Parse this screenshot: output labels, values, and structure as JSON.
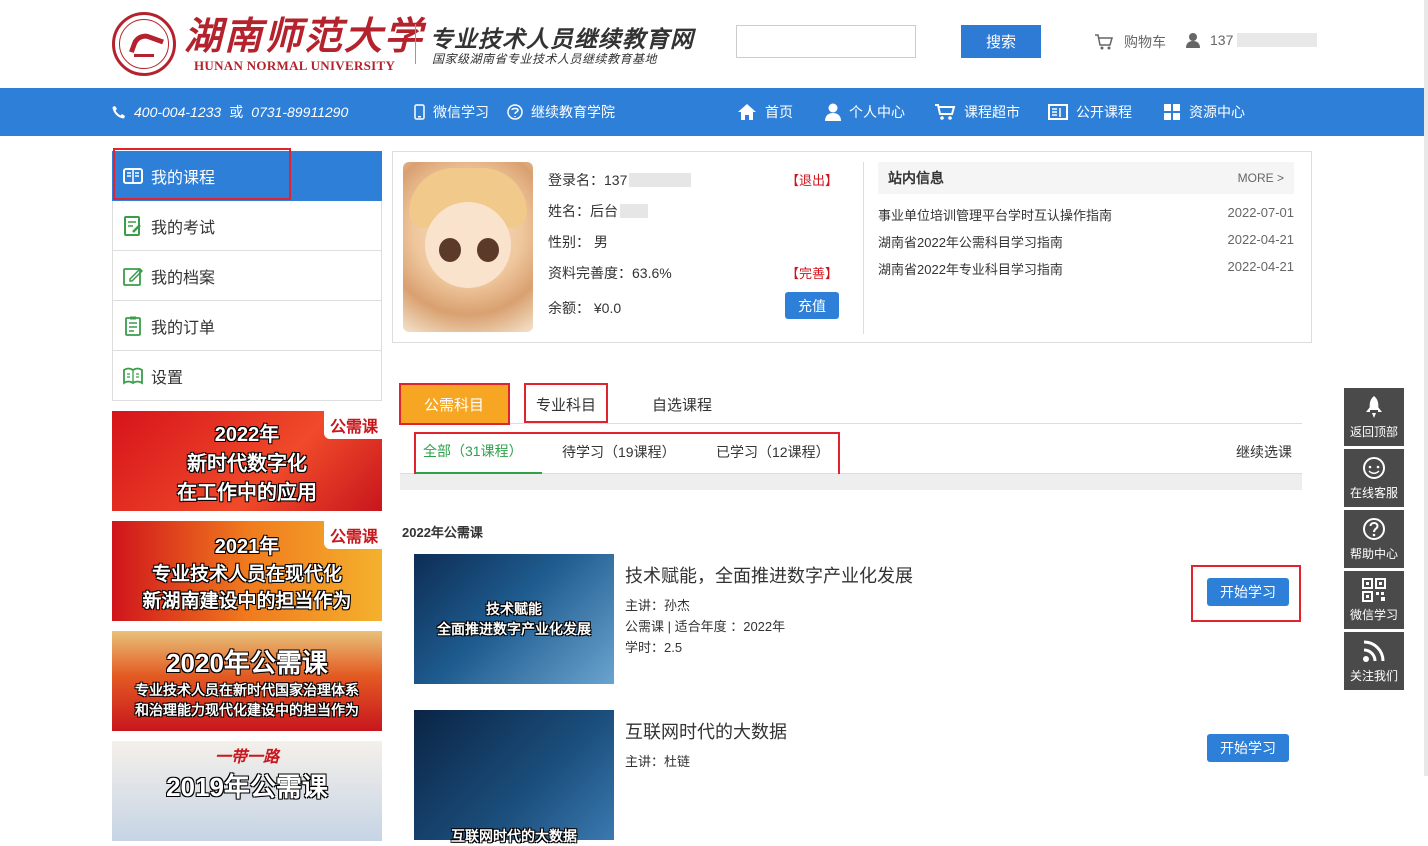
{
  "header": {
    "logo_cn": "湖南师范大学",
    "logo_en": "HUNAN NORMAL UNIVERSITY",
    "site_title": "专业技术人员继续教育网",
    "site_subtitle": "国家级湖南省专业技术人员继续教育基地",
    "search_button": "搜索",
    "cart_label": "购物车",
    "user_label": "137"
  },
  "navbar": {
    "phone1": "400-004-1233",
    "or": "或",
    "phone2": "0731-89911290",
    "wechat": "微信学习",
    "college": "继续教育学院",
    "home": "首页",
    "personal": "个人中心",
    "market": "课程超市",
    "public": "公开课程",
    "resources": "资源中心"
  },
  "sidebar": {
    "items": [
      {
        "label": "我的课程"
      },
      {
        "label": "我的考试"
      },
      {
        "label": "我的档案"
      },
      {
        "label": "我的订单"
      },
      {
        "label": "设置"
      }
    ],
    "banners": [
      {
        "tag": "公需课",
        "line1": "2022年",
        "line2": "新时代数字化",
        "line3": "在工作中的应用"
      },
      {
        "tag": "公需课",
        "line1": "2021年",
        "line2": "专业技术人员在现代化",
        "line3": "新湖南建设中的担当作为"
      },
      {
        "line1": "2020年公需课",
        "line2": "专业技术人员在新时代国家治理体系",
        "line3": "和治理能力现代化建设中的担当作为"
      },
      {
        "line1": "一带一路",
        "line2": "2019年公需课"
      }
    ]
  },
  "profile": {
    "login_label": "登录名：137",
    "logout": "【退出】",
    "name_label": "姓名：后台",
    "gender_label": "性别：",
    "gender": "男",
    "completeness_label": "资料完善度：63.6%",
    "complete_link": "【完善】",
    "balance_label": "余额：",
    "balance": "¥0.0",
    "recharge": "充值"
  },
  "news": {
    "title": "站内信息",
    "more": "MORE >",
    "items": [
      {
        "text": "事业单位培训管理平台学时互认操作指南",
        "date": "2022-07-01"
      },
      {
        "text": "湖南省2022年公需科目学习指南",
        "date": "2022-04-21"
      },
      {
        "text": "湖南省2022年专业科目学习指南",
        "date": "2022-04-21"
      }
    ]
  },
  "tabs": {
    "public": "公需科目",
    "professional": "专业科目",
    "elective": "自选课程"
  },
  "subtabs": {
    "all": "全部（31课程）",
    "pending": "待学习（19课程）",
    "done": "已学习（12课程）",
    "continue": "继续选课"
  },
  "year_label": "2022年公需课",
  "courses": [
    {
      "thumb_line1": "技术赋能",
      "thumb_line2": "全面推进数字产业化发展",
      "title": "技术赋能，全面推进数字产业化发展",
      "lecturer": "主讲：孙杰",
      "meta": "公需课 |  适合年度 ：2022年",
      "hours": "学时：2.5",
      "button": "开始学习"
    },
    {
      "thumb_line1": "互联网时代的大数据",
      "title": "互联网时代的大数据",
      "lecturer": "主讲：杜链",
      "button": "开始学习"
    }
  ],
  "rightbar": {
    "top": "返回顶部",
    "service": "在线客服",
    "help": "帮助中心",
    "wechat": "微信学习",
    "follow": "关注我们"
  },
  "colors": {
    "brand_red": "#b4232d",
    "nav_blue": "#2e7fd8",
    "tab_orange": "#f6a623",
    "highlight_red": "#e0232c",
    "subtab_green": "#2da24a"
  }
}
